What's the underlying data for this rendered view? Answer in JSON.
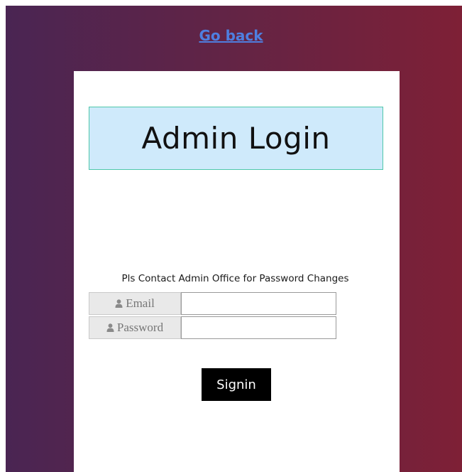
{
  "nav": {
    "go_back_label": "Go back"
  },
  "login": {
    "title": "Admin Login",
    "note": "Pls Contact Admin Office for Password Changes",
    "email": {
      "label": "Email",
      "icon": "user-icon",
      "value": ""
    },
    "password": {
      "label": "Password",
      "icon": "user-icon",
      "value": ""
    },
    "signin_label": "Signin"
  },
  "colors": {
    "gradient_left": "#4a2553",
    "gradient_right": "#7e2036",
    "link": "#4e7fe0",
    "title_bg": "#cfeafb",
    "title_border": "#4fc7aa",
    "button_bg": "#000000"
  }
}
